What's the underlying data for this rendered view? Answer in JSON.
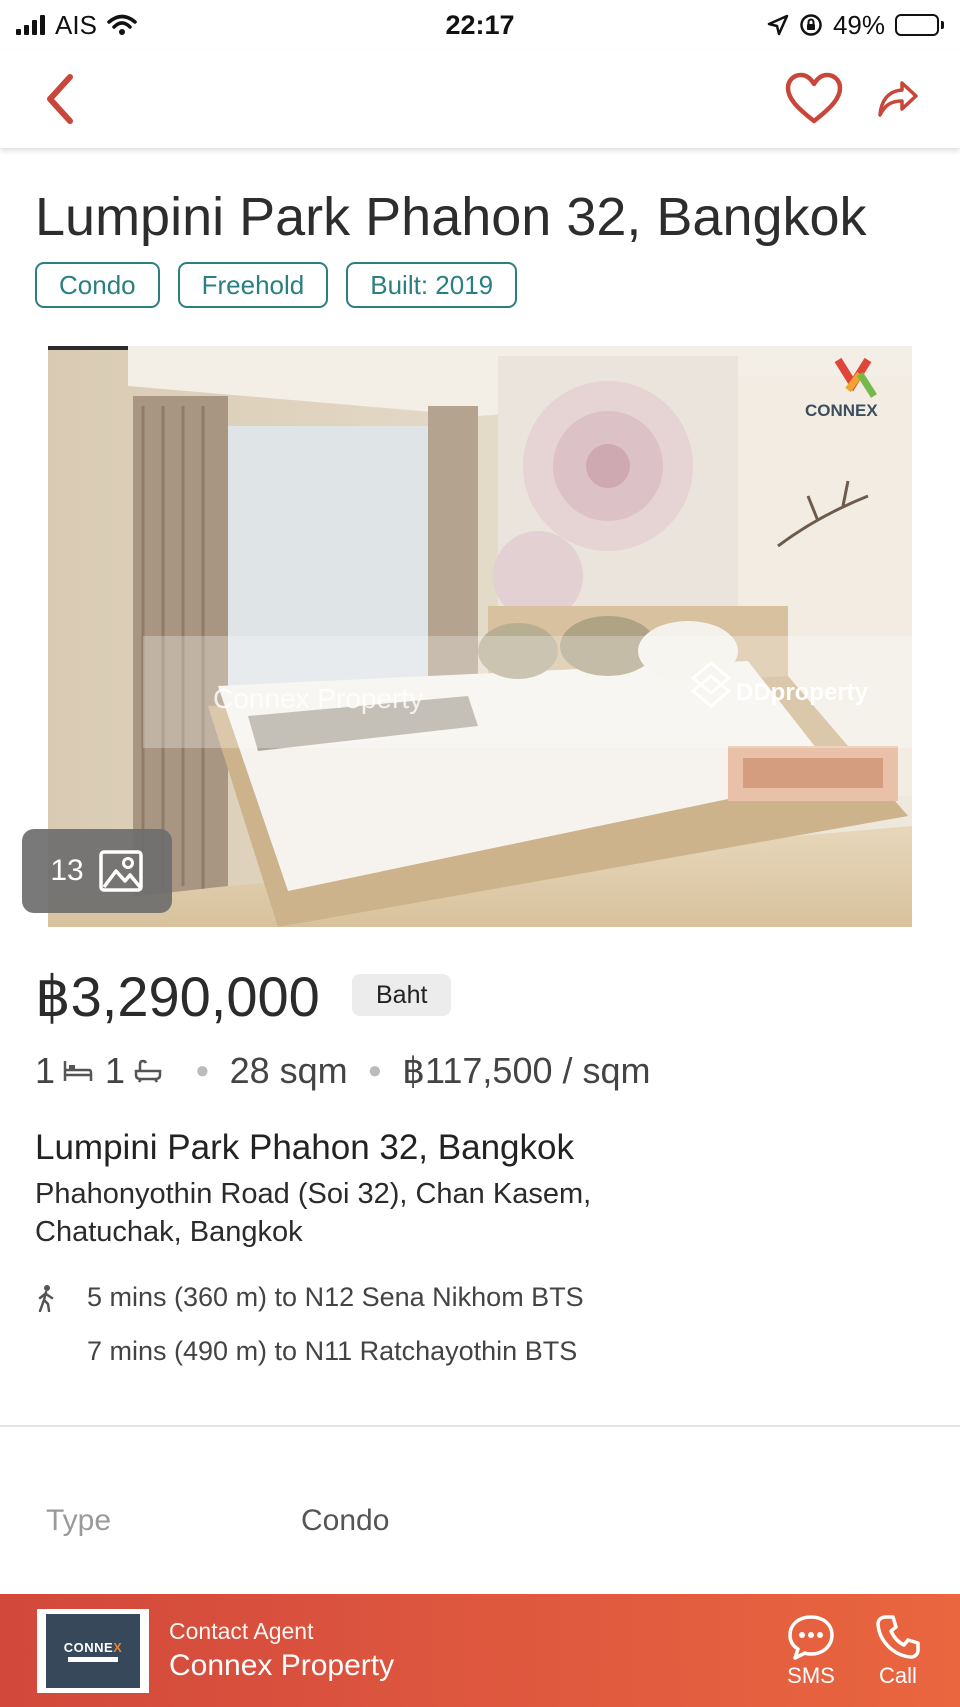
{
  "status_bar": {
    "carrier": "AIS",
    "time": "22:17",
    "battery_percent": "49%",
    "battery_level": 0.49,
    "icons": [
      "signal-icon",
      "wifi-icon",
      "location-arrow-icon",
      "orientation-lock-icon",
      "battery-charging-icon"
    ]
  },
  "nav": {
    "icons": [
      "back-chevron-icon",
      "heart-icon",
      "share-icon"
    ],
    "accent_color": "#c8463a"
  },
  "listing": {
    "title": "Lumpini Park Phahon 32, Bangkok",
    "tags": [
      "Condo",
      "Freehold",
      "Built: 2019"
    ],
    "photo": {
      "count": "13",
      "watermark_left": "Connex Property",
      "watermark_right": "DDproperty",
      "brand_logo": "CONNEX"
    },
    "price": "฿3,290,000",
    "currency_label": "Baht",
    "bedrooms": "1",
    "bathrooms": "1",
    "area": "28 sqm",
    "price_per_sqm": "฿117,500 / sqm",
    "project_name": "Lumpini Park Phahon 32, Bangkok",
    "address_line1": "Phahonyothin Road (Soi 32), Chan Kasem,",
    "address_line2": "Chatuchak, Bangkok",
    "transit": [
      "5 mins (360 m) to N12 Sena Nikhom BTS",
      "7 mins (490 m) to N11 Ratchayothin BTS"
    ],
    "details": [
      {
        "label": "Type",
        "value": "Condo"
      }
    ]
  },
  "contact": {
    "label": "Contact Agent",
    "agent_name": "Connex Property",
    "sms_label": "SMS",
    "call_label": "Call"
  },
  "colors": {
    "tag_teal": "#2a7f80",
    "contact_bar_start": "#d2483b",
    "contact_bar_end": "#e9663f"
  }
}
